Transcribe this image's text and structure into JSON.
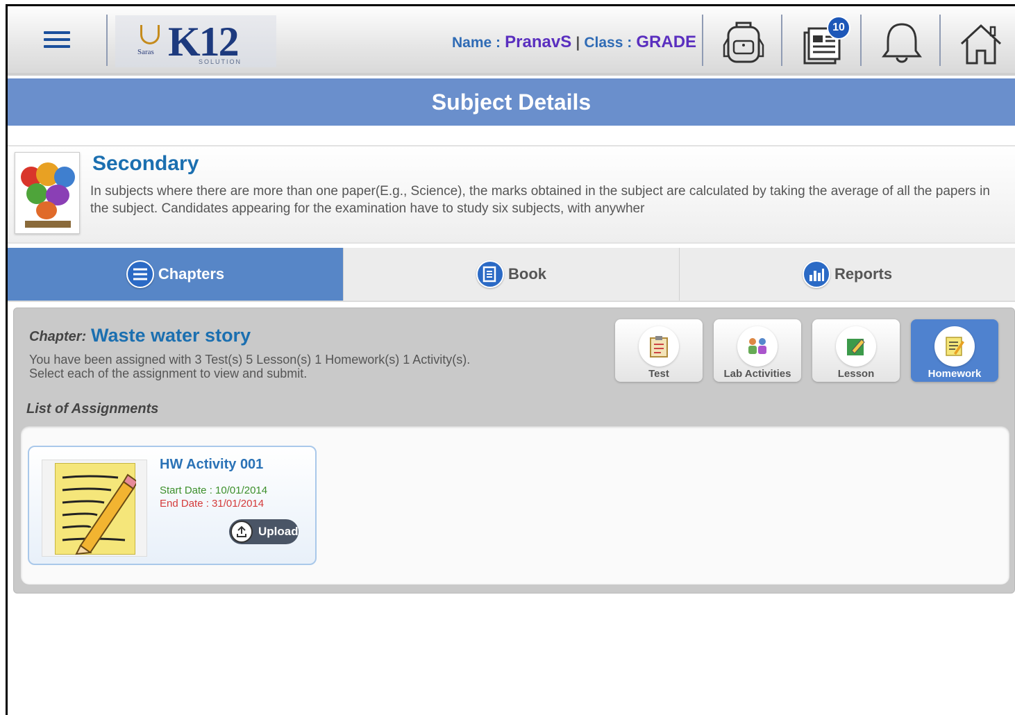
{
  "header": {
    "logo_text": "K12",
    "logo_brand": "Saras",
    "logo_sub": "SOLUTION",
    "name_label": "Name :",
    "name_value": "PranavS",
    "separator": "|",
    "class_label": "Class :",
    "class_value": "GRADE",
    "notifications_badge": "10",
    "icons": [
      "menu-icon",
      "backpack-icon",
      "assignments-icon",
      "bell-icon",
      "home-icon"
    ]
  },
  "page": {
    "title": "Subject Details"
  },
  "subject": {
    "title": "Secondary",
    "description": "In subjects where there are more than one paper(E.g., Science), the marks obtained in the subject are calculated by taking the average of all the papers in the subject. Candidates appearing for the examination have to study six subjects, with anywher"
  },
  "tabs": [
    {
      "label": "Chapters",
      "icon": "chapters-icon",
      "active": true
    },
    {
      "label": "Book",
      "icon": "book-icon",
      "active": false
    },
    {
      "label": "Reports",
      "icon": "reports-icon",
      "active": false
    }
  ],
  "chapter": {
    "label": "Chapter:",
    "name": "Waste water story",
    "description": "You have been assigned with 3 Test(s) 5 Lesson(s) 1 Homework(s) 1 Activity(s). Select each of the assignment to view and submit."
  },
  "assignment_types": [
    {
      "label": "Test",
      "icon": "clipboard-icon",
      "active": false
    },
    {
      "label": "Lab Activities",
      "icon": "lab-activities-icon",
      "active": false
    },
    {
      "label": "Lesson",
      "icon": "lesson-icon",
      "active": false
    },
    {
      "label": "Homework",
      "icon": "homework-icon",
      "active": true
    }
  ],
  "list_label": "List of Assignments",
  "assignments": [
    {
      "title": "HW Activity 001",
      "start_date": "Start Date : 10/01/2014",
      "end_date": "End Date : 31/01/2014",
      "action_label": "Upload"
    }
  ],
  "colors": {
    "title_bar": "#6a8fcc",
    "active_tab": "#5786c7",
    "subject_title": "#1b6fb0",
    "start_date": "#3c8f2a",
    "end_date": "#d43a3a",
    "badge": "#1d57b8"
  }
}
